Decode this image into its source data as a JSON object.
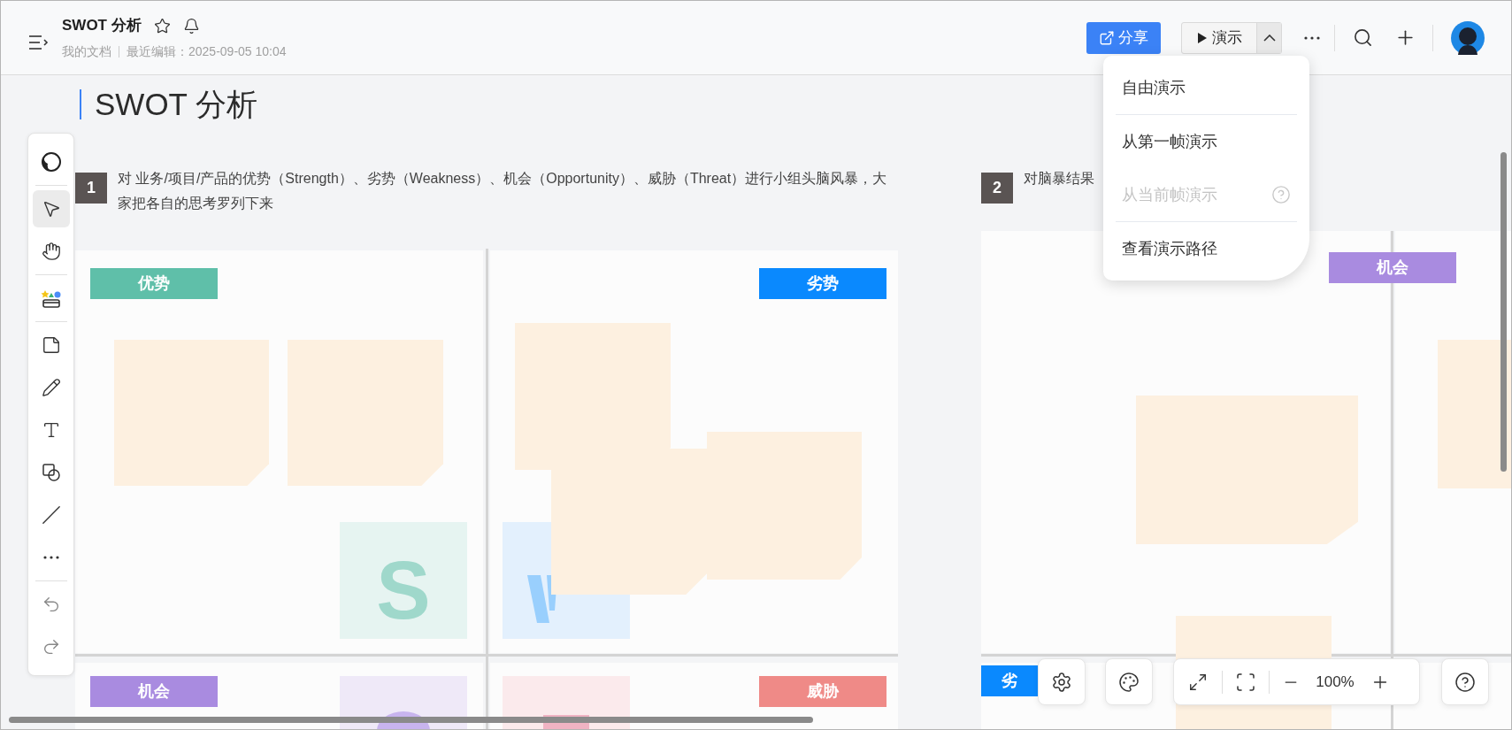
{
  "header": {
    "title": "SWOT 分析",
    "location": "我的文档",
    "last_edited": "最近编辑：2025-09-05 10:04",
    "share_button": "分享",
    "present_button": "演示",
    "present_menu_expanded": true
  },
  "present_menu": [
    {
      "label": "自由演示",
      "disabled": false,
      "help": false
    },
    {
      "label": "从第一帧演示",
      "disabled": false,
      "help": false
    },
    {
      "label": "从当前帧演示",
      "disabled": true,
      "help": true
    },
    {
      "label": "查看演示路径",
      "disabled": false,
      "help": false
    }
  ],
  "toolbar": [
    {
      "kind": "theme",
      "selected": false
    },
    {
      "kind": "select",
      "selected": true
    },
    {
      "kind": "hand",
      "selected": false
    },
    {
      "kind": "materials",
      "selected": false
    },
    {
      "kind": "sticky",
      "selected": false
    },
    {
      "kind": "pen",
      "selected": false
    },
    {
      "kind": "text",
      "selected": false
    },
    {
      "kind": "shape",
      "selected": false
    },
    {
      "kind": "line",
      "selected": false
    },
    {
      "kind": "more",
      "selected": false
    },
    {
      "kind": "undo",
      "selected": false
    },
    {
      "kind": "redo",
      "selected": false
    }
  ],
  "canvas": {
    "heading": "SWOT 分析",
    "steps": [
      {
        "number": "1",
        "text": "对 业务/项目/产品的优势（Strength）、劣势（Weakness）、机会（Opportunity）、威胁（Threat）进行小组头脑风暴，大家把各自的思考罗列下来"
      },
      {
        "number": "2",
        "text": "对脑暴结果"
      }
    ],
    "tags": [
      {
        "label": "优势",
        "color": "#5fbfa9"
      },
      {
        "label": "劣势",
        "color": "#0a89fe"
      },
      {
        "label": "机会",
        "color": "#a98be0"
      },
      {
        "label": "威胁",
        "color": "#ef8a87"
      },
      {
        "label": "机会",
        "color": "#a98be0"
      },
      {
        "label": "劣",
        "color": "#0a89fe"
      }
    ],
    "letter_tiles": [
      {
        "letter": "S",
        "color": "#9fd8cb"
      }
    ]
  },
  "zoom": {
    "reading": "100%"
  }
}
